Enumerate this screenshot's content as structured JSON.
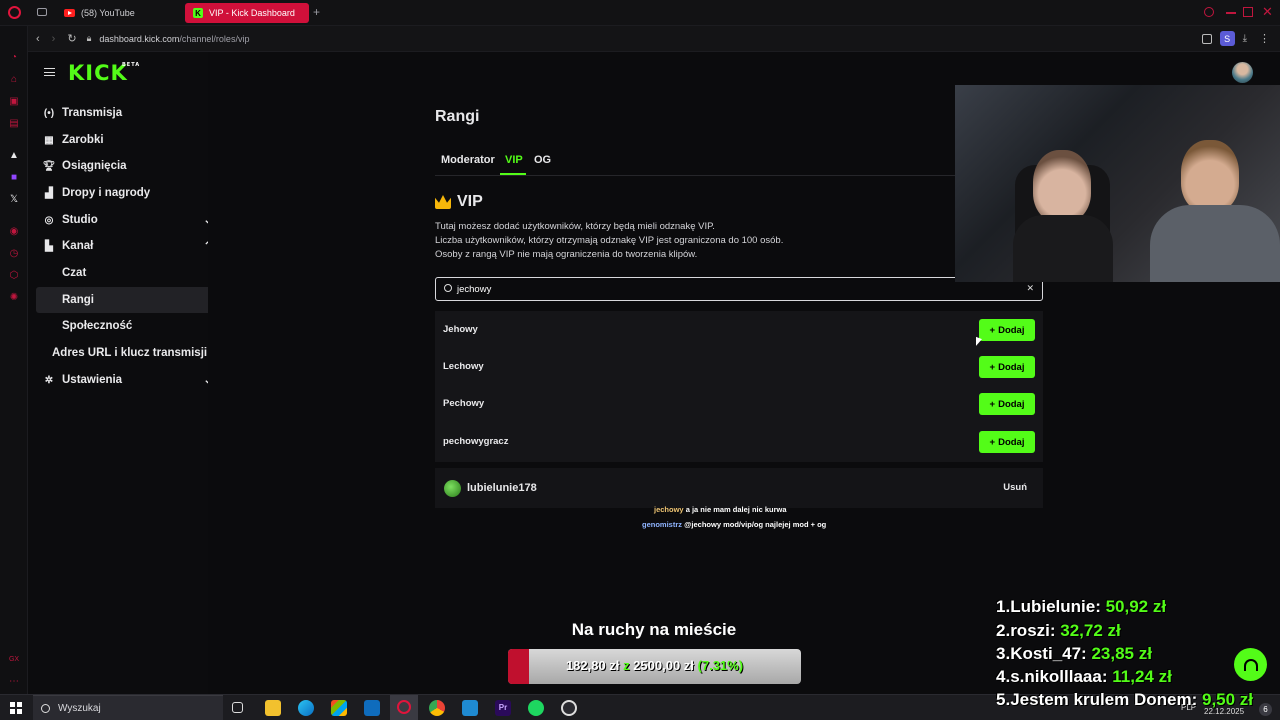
{
  "browser": {
    "tabs": [
      {
        "label": "(58) YouTube"
      },
      {
        "label": "VIP - Kick Dashboard"
      }
    ],
    "url_host": "dashboard.kick.com",
    "url_path": "/channel/roles/vip",
    "profile_initial": "S"
  },
  "kick": {
    "logo": "KICK",
    "logo_badge": "BETA",
    "nav": [
      {
        "label": "Transmisja",
        "icon": "broadcast-icon"
      },
      {
        "label": "Zarobki",
        "icon": "earnings-icon"
      },
      {
        "label": "Osiągnięcia",
        "icon": "trophy-icon"
      },
      {
        "label": "Dropy i nagrody",
        "icon": "drops-icon"
      },
      {
        "label": "Studio",
        "icon": "studio-icon"
      },
      {
        "label": "Kanał",
        "icon": "channel-icon"
      },
      {
        "label": "Czat"
      },
      {
        "label": "Rangi"
      },
      {
        "label": "Społeczność"
      },
      {
        "label": "Adres URL i klucz transmisji"
      },
      {
        "label": "Ustawienia",
        "icon": "settings-icon"
      }
    ]
  },
  "page": {
    "title": "Rangi",
    "tabs": [
      "Moderator",
      "VIP",
      "OG"
    ],
    "active_tab": "VIP",
    "section_title": "VIP",
    "description": [
      "Tutaj możesz dodać użytkowników, którzy będą mieli odznakę VIP.",
      "Liczba użytkowników, którzy otrzymają odznakę VIP jest ograniczona do 100 osób.",
      "Osoby z rangą VIP nie mają ograniczenia do tworzenia klipów."
    ],
    "search_value": "jechowy",
    "results": [
      {
        "name": "Jehowy",
        "action": "Dodaj"
      },
      {
        "name": "Lechowy",
        "action": "Dodaj"
      },
      {
        "name": "Pechowy",
        "action": "Dodaj"
      },
      {
        "name": "pechowygracz",
        "action": "Dodaj"
      }
    ],
    "vip_users": [
      {
        "name": "lubielunie178",
        "action": "Usuń"
      }
    ]
  },
  "overlay": {
    "chat": [
      {
        "user": "jechowy",
        "message": "a ja nie mam dalej nic kurwa",
        "color": "#f0c674"
      },
      {
        "user": "genomistrz",
        "message": "@jechowy mod/vip/og najlejej mod + og",
        "color": "#8fb4ff"
      }
    ],
    "goal_title": "Na ruchy na mieście",
    "goal_current": "182,80 zł",
    "goal_sep": "z",
    "goal_target": "2500,00 zł",
    "goal_percent": "(7.31%)",
    "goal_progress": 0.0731,
    "leaderboard": [
      {
        "rank": "1.",
        "name": "Lubielunie:",
        "amount": "50,92 zł"
      },
      {
        "rank": "2.",
        "name": "roszi:",
        "amount": "32,72 zł"
      },
      {
        "rank": "3.",
        "name": "Kosti_47:",
        "amount": "23,85 zł"
      },
      {
        "rank": "4.",
        "name": "s.nikolllaaa:",
        "amount": "11,24 zł"
      },
      {
        "rank": "5.",
        "name": "Jestem krulem Donem:",
        "amount": "9,50 zł"
      }
    ]
  },
  "taskbar": {
    "search_placeholder": "Wyszukaj",
    "lang": "PLP",
    "date": "22.12.2025",
    "notif_count": "6"
  },
  "colors": {
    "kick_green": "#53fc18",
    "tab_active": "#d0103a"
  }
}
